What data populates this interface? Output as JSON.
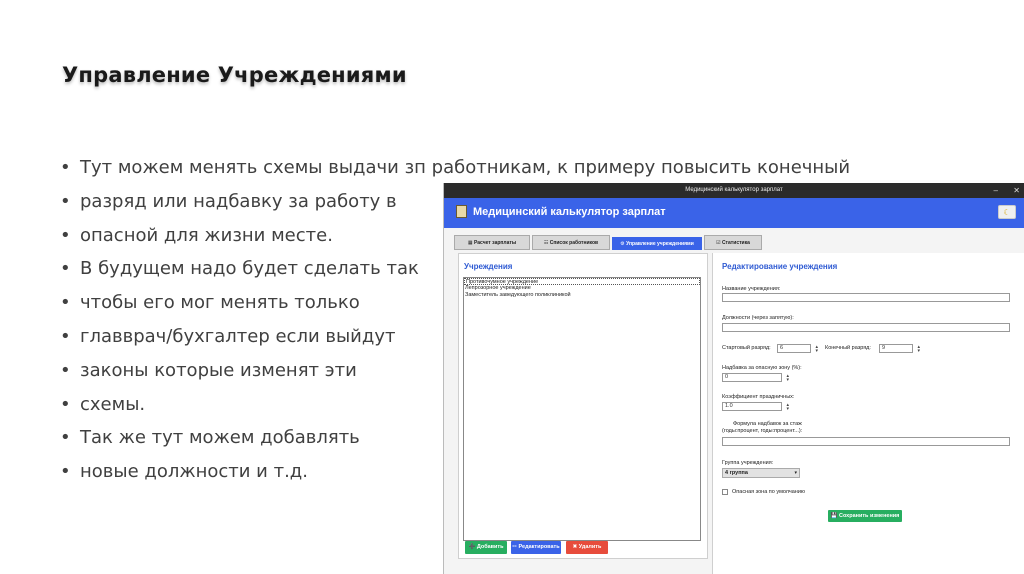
{
  "slide": {
    "title": "Управление Учреждениями",
    "bullets": [
      "Тут можем менять схемы выдачи зп работникам, к примеру повысить конечный",
      "разряд или надбавку за работу в",
      "опасной для жизни месте.",
      "В будущем надо будет сделать так",
      "чтобы его мог менять только",
      "главврач/бухгалтер если выйдут",
      "законы которые изменят эти",
      "схемы.",
      "Так же тут можем добавлять",
      "новые должности и т.д."
    ]
  },
  "window": {
    "titlebar": "Медицинский калькулятор зарплат",
    "min_glyph": "–",
    "close_glyph": "✕",
    "app_title": "Медицинский калькулятор зарплат",
    "theme_icon": "moon-icon",
    "theme_glyph": "☾",
    "tabs": [
      {
        "label": "▦ Расчет зарплаты"
      },
      {
        "label": "☷ Список работников"
      },
      {
        "label": "⚙ Управление учреждениями"
      },
      {
        "label": "☑ Статистика"
      }
    ],
    "left_panel": {
      "title": "Учреждения",
      "items": [
        "Противочумное учреждение",
        "Лепрозорное учреждение",
        "Заместитель заведующего поликлиникой"
      ],
      "buttons": {
        "add": "➕ Добавить",
        "edit": "✏ Редактировать",
        "delete": "✖ Удалить"
      }
    },
    "right_panel": {
      "title": "Редактирование учреждения",
      "name_label": "Название учреждения:",
      "name_value": "",
      "positions_label": "Должности (через запятую):",
      "positions_value": "",
      "start_grade_label": "Стартовый разряд:",
      "start_grade_value": "6",
      "end_grade_label": "Конечный разряд:",
      "end_grade_value": "9",
      "danger_bonus_label": "Надбавка за опасную зону (%):",
      "danger_bonus_value": "0",
      "holiday_coef_label": "Коэффициент праздничных:",
      "holiday_coef_value": "1.0",
      "formula_label_1": "Формула надбавок за стаж",
      "formula_label_2": "(годы:процент, годы:процент...):",
      "formula_value": "",
      "group_label": "Группа учреждения:",
      "group_value": "4 группа",
      "danger_default_label": "Опасная зона по умолчанию",
      "save_button": "💾 Сохранить изменения"
    }
  }
}
